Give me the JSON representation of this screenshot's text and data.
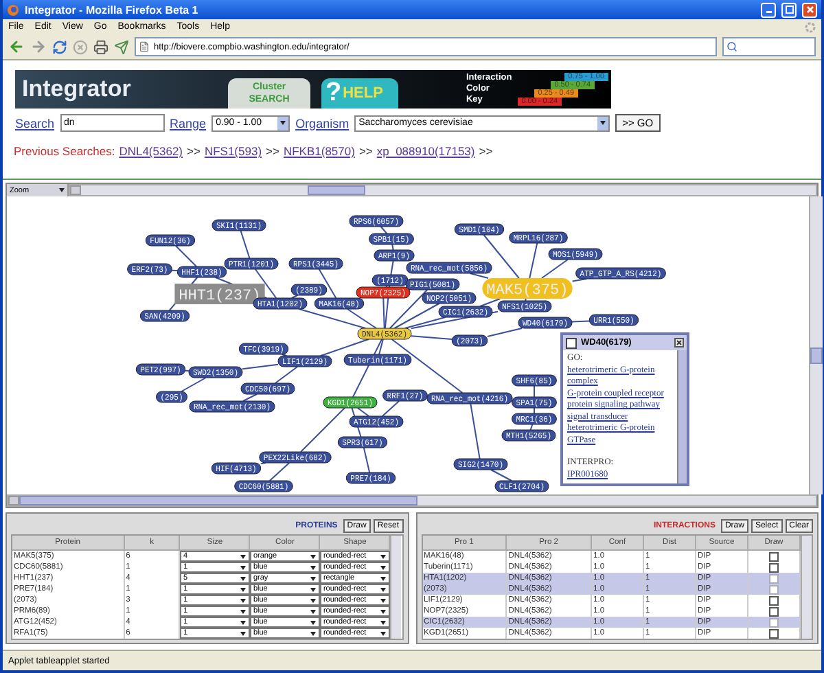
{
  "window": {
    "title": "Integrator - Mozilla Firefox Beta 1"
  },
  "menu": [
    "File",
    "Edit",
    "View",
    "Go",
    "Bookmarks",
    "Tools",
    "Help"
  ],
  "address": {
    "url": "http://biovere.compbio.washington.edu/integrator/"
  },
  "banner": {
    "title": "Integrator",
    "cluster_tab": [
      "Cluster",
      "SEARCH"
    ],
    "help": {
      "mark": "?",
      "label": "HELP"
    },
    "key_labels": [
      "Interaction",
      "Color",
      "Key"
    ],
    "key": [
      {
        "range": "0.75 - 1.00",
        "color": "#2a9ad0"
      },
      {
        "range": "0.50 - 0.74",
        "color": "#5aa838"
      },
      {
        "range": "0.25 - 0.49",
        "color": "#e88a20"
      },
      {
        "range": "0.00 - 0.24",
        "color": "#d82828"
      }
    ]
  },
  "search": {
    "search_label": "Search",
    "query": "dn",
    "range_label": "Range",
    "range": "0.90 - 1.00",
    "organism_label": "Organism",
    "organism": "Saccharomyces cerevisiae",
    "go": ">> GO"
  },
  "previous_searches": {
    "label": "Previous Searches:",
    "items": [
      {
        "link": "DNL4(5362)",
        "separator": ">>"
      },
      {
        "link": "NFS1(593)",
        "separator": ">>"
      },
      {
        "link": "NFKB1(8570)",
        "separator": ">>"
      },
      {
        "link": "xp_088910(17153)",
        "separator": ">>"
      }
    ]
  },
  "graph": {
    "zoom": "Zoom",
    "nodes": [
      {
        "label": "SKI1(1131)",
        "color": "#3a4f9a",
        "kind": "normal"
      },
      {
        "label": "RPS6(6057)",
        "color": "#3a4f9a",
        "kind": "normal"
      },
      {
        "label": "SMD1(104)",
        "color": "#3a4f9a",
        "kind": "normal"
      },
      {
        "label": "FUN12(36)",
        "color": "#3a4f9a",
        "kind": "normal"
      },
      {
        "label": "SPB1(15)",
        "color": "#3a4f9a",
        "kind": "normal"
      },
      {
        "label": "MRPL16(287)",
        "color": "#3a4f9a",
        "kind": "normal"
      },
      {
        "label": "PTR1(1201)",
        "color": "#3a4f9a",
        "kind": "normal"
      },
      {
        "label": "RPS1(3445)",
        "color": "#3a4f9a",
        "kind": "normal"
      },
      {
        "label": "ARP1(9)",
        "color": "#3a4f9a",
        "kind": "normal"
      },
      {
        "label": "MOS1(5949)",
        "color": "#3a4f9a",
        "kind": "normal"
      },
      {
        "label": "ERF2(73)",
        "color": "#3a4f9a",
        "kind": "normal"
      },
      {
        "label": "HHF1(238)",
        "color": "#3a4f9a",
        "kind": "normal"
      },
      {
        "label": "RNA_rec_mot(5856)",
        "color": "#3a4f9a",
        "kind": "normal"
      },
      {
        "label": "ATP_GTP_A_RS(4212)",
        "color": "#3a4f9a",
        "kind": "normal"
      },
      {
        "label": "HHT1(237)",
        "color": "#8c8c8c",
        "kind": "large"
      },
      {
        "label": "HTA1(1202)",
        "color": "#3a4f9a",
        "kind": "normal"
      },
      {
        "label": "(2389)",
        "color": "#3a4f9a",
        "kind": "normal"
      },
      {
        "label": "MAK16(48)",
        "color": "#3a4f9a",
        "kind": "normal"
      },
      {
        "label": "(1712)",
        "color": "#3a4f9a",
        "kind": "normal"
      },
      {
        "label": "NOP7(2325)",
        "color": "#e03020",
        "kind": "normal"
      },
      {
        "label": "PIG1(5081)",
        "color": "#3a4f9a",
        "kind": "normal"
      },
      {
        "label": "NOP2(5051)",
        "color": "#3a4f9a",
        "kind": "normal"
      },
      {
        "label": "MAK5(375)",
        "color": "#f0c020",
        "kind": "large"
      },
      {
        "label": "SAN(4209)",
        "color": "#3a4f9a",
        "kind": "normal"
      },
      {
        "label": "CIC1(2632)",
        "color": "#3a4f9a",
        "kind": "normal"
      },
      {
        "label": "NFS1(1025)",
        "color": "#3a4f9a",
        "kind": "normal"
      },
      {
        "label": "WD40(6179)",
        "color": "#3a4f9a",
        "kind": "normal"
      },
      {
        "label": "URR1(550)",
        "color": "#3a4f9a",
        "kind": "normal"
      },
      {
        "label": "DNL4(5362)",
        "color": "#e8c840",
        "kind": "normal"
      },
      {
        "label": "(2073)",
        "color": "#3a4f9a",
        "kind": "normal"
      },
      {
        "label": "TFC(3919)",
        "color": "#3a4f9a",
        "kind": "normal"
      },
      {
        "label": "PET2(997)",
        "color": "#3a4f9a",
        "kind": "normal"
      },
      {
        "label": "SWD2(1350)",
        "color": "#3a4f9a",
        "kind": "normal"
      },
      {
        "label": "LIF1(2129)",
        "color": "#3a4f9a",
        "kind": "normal"
      },
      {
        "label": "Tuberin(1171)",
        "color": "#3a4f9a",
        "kind": "normal"
      },
      {
        "label": "SHF6(85)",
        "color": "#3a4f9a",
        "kind": "normal"
      },
      {
        "label": "(295)",
        "color": "#3a4f9a",
        "kind": "normal"
      },
      {
        "label": "CDC50(697)",
        "color": "#3a4f9a",
        "kind": "normal"
      },
      {
        "label": "RNA_rec_mot(2130)",
        "color": "#3a4f9a",
        "kind": "normal"
      },
      {
        "label": "KGD1(2651)",
        "color": "#40b040",
        "kind": "normal"
      },
      {
        "label": "RRF1(27)",
        "color": "#3a4f9a",
        "kind": "normal"
      },
      {
        "label": "RNA_rec_mot(4216)",
        "color": "#3a4f9a",
        "kind": "normal"
      },
      {
        "label": "SPA1(75)",
        "color": "#3a4f9a",
        "kind": "normal"
      },
      {
        "label": "ATG12(452)",
        "color": "#3a4f9a",
        "kind": "normal"
      },
      {
        "label": "MRC1(36)",
        "color": "#3a4f9a",
        "kind": "normal"
      },
      {
        "label": "SPR3(617)",
        "color": "#3a4f9a",
        "kind": "normal"
      },
      {
        "label": "MTH1(5265)",
        "color": "#3a4f9a",
        "kind": "normal"
      },
      {
        "label": "HIF(4713)",
        "color": "#3a4f9a",
        "kind": "normal"
      },
      {
        "label": "PEX22Like(682)",
        "color": "#3a4f9a",
        "kind": "normal"
      },
      {
        "label": "SIG2(1470)",
        "color": "#3a4f9a",
        "kind": "normal"
      },
      {
        "label": "CDC60(5881)",
        "color": "#3a4f9a",
        "kind": "normal"
      },
      {
        "label": "PRE7(184)",
        "color": "#3a4f9a",
        "kind": "normal"
      },
      {
        "label": "CLF1(2704)",
        "color": "#3a4f9a",
        "kind": "normal"
      }
    ],
    "popup": {
      "title": "WD40(6179)",
      "checked": false,
      "go_label": "GO:",
      "go_terms": [
        "heterotrimeric G-protein complex",
        "G-protein coupled receptor protein signaling pathway",
        "signal transducer",
        "heterotrimeric G-protein GTPase"
      ],
      "interpro_label": "INTERPRO:",
      "interpro_terms": [
        "IPR001680"
      ]
    }
  },
  "proteins": {
    "title": "PROTEINS",
    "buttons": [
      "Draw",
      "Reset"
    ],
    "columns": [
      "Protein",
      "k",
      "Size",
      "Color",
      "Shape"
    ],
    "rows": [
      {
        "protein": "MAK5(375)",
        "k": "6",
        "size": "4",
        "color_name": "orange",
        "shape": "rounded-rect"
      },
      {
        "protein": "CDC60(5881)",
        "k": "1",
        "size": "1",
        "color_name": "blue",
        "shape": "rounded-rect"
      },
      {
        "protein": "HHT1(237)",
        "k": "4",
        "size": "5",
        "color_name": "gray",
        "shape": "rectangle"
      },
      {
        "protein": "PRE7(184)",
        "k": "1",
        "size": "1",
        "color_name": "blue",
        "shape": "rounded-rect"
      },
      {
        "protein": "(2073)",
        "k": "3",
        "size": "1",
        "color_name": "blue",
        "shape": "rounded-rect"
      },
      {
        "protein": "PRM6(89)",
        "k": "1",
        "size": "1",
        "color_name": "blue",
        "shape": "rounded-rect"
      },
      {
        "protein": "ATG12(452)",
        "k": "4",
        "size": "1",
        "color_name": "blue",
        "shape": "rounded-rect"
      },
      {
        "protein": "RFA1(75)",
        "k": "6",
        "size": "1",
        "color_name": "blue",
        "shape": "rounded-rect"
      }
    ]
  },
  "interactions": {
    "title": "INTERACTIONS",
    "buttons": [
      "Draw",
      "Select",
      "Clear"
    ],
    "columns": [
      "Pro 1",
      "Pro 2",
      "Conf",
      "Dist",
      "Source",
      "Draw"
    ],
    "rows": [
      {
        "pro1": "MAK16(48)",
        "pro2": "DNL4(5362)",
        "conf": "1.0",
        "dist": "1",
        "source": "DIP",
        "draw": false,
        "selected": false
      },
      {
        "pro1": "Tuberin(1171)",
        "pro2": "DNL4(5362)",
        "conf": "1.0",
        "dist": "1",
        "source": "DIP",
        "draw": false,
        "selected": false
      },
      {
        "pro1": "HTA1(1202)",
        "pro2": "DNL4(5362)",
        "conf": "1.0",
        "dist": "1",
        "source": "DIP",
        "draw": false,
        "selected": true
      },
      {
        "pro1": "(2073)",
        "pro2": "DNL4(5362)",
        "conf": "1.0",
        "dist": "1",
        "source": "DIP",
        "draw": false,
        "selected": true
      },
      {
        "pro1": "LIF1(2129)",
        "pro2": "DNL4(5362)",
        "conf": "1.0",
        "dist": "1",
        "source": "DIP",
        "draw": false,
        "selected": false
      },
      {
        "pro1": "NOP7(2325)",
        "pro2": "DNL4(5362)",
        "conf": "1.0",
        "dist": "1",
        "source": "DIP",
        "draw": false,
        "selected": false
      },
      {
        "pro1": "CIC1(2632)",
        "pro2": "DNL4(5362)",
        "conf": "1.0",
        "dist": "1",
        "source": "DIP",
        "draw": false,
        "selected": true
      },
      {
        "pro1": "KGD1(2651)",
        "pro2": "DNL4(5362)",
        "conf": "1.0",
        "dist": "1",
        "source": "DIP",
        "draw": false,
        "selected": false
      }
    ]
  },
  "status_bar": "Applet tableapplet started"
}
